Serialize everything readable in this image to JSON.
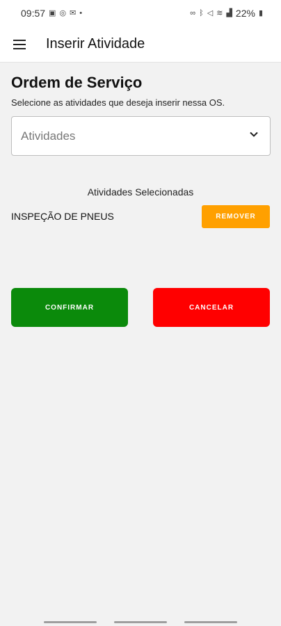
{
  "status_bar": {
    "time": "09:57",
    "left_icons": [
      "image-icon",
      "whatsapp-icon",
      "mail-icon",
      "dot-icon"
    ],
    "right_icons": [
      "link-icon",
      "bluetooth-icon",
      "mute-icon",
      "wifi-icon",
      "signal-icon",
      "battery-icon"
    ],
    "battery": "22%"
  },
  "app_bar": {
    "title": "Inserir Atividade",
    "menu_icon": "hamburger-menu-icon"
  },
  "main": {
    "title": "Ordem de Serviço",
    "subtitle": "Selecione as atividades que deseja inserir nessa OS.",
    "select": {
      "placeholder": "Atividades",
      "icon": "chevron-down-icon"
    },
    "selected_header": "Atividades Selecionadas",
    "selected_items": [
      {
        "label": "INSPEÇÃO DE PNEUS",
        "action_label": "REMOVER"
      }
    ],
    "confirm_label": "CONFIRMAR",
    "cancel_label": "CANCELAR"
  },
  "colors": {
    "remove": "#ffa000",
    "confirm": "#0b8a0b",
    "cancel": "#ff0000",
    "background": "#f2f2f2"
  }
}
